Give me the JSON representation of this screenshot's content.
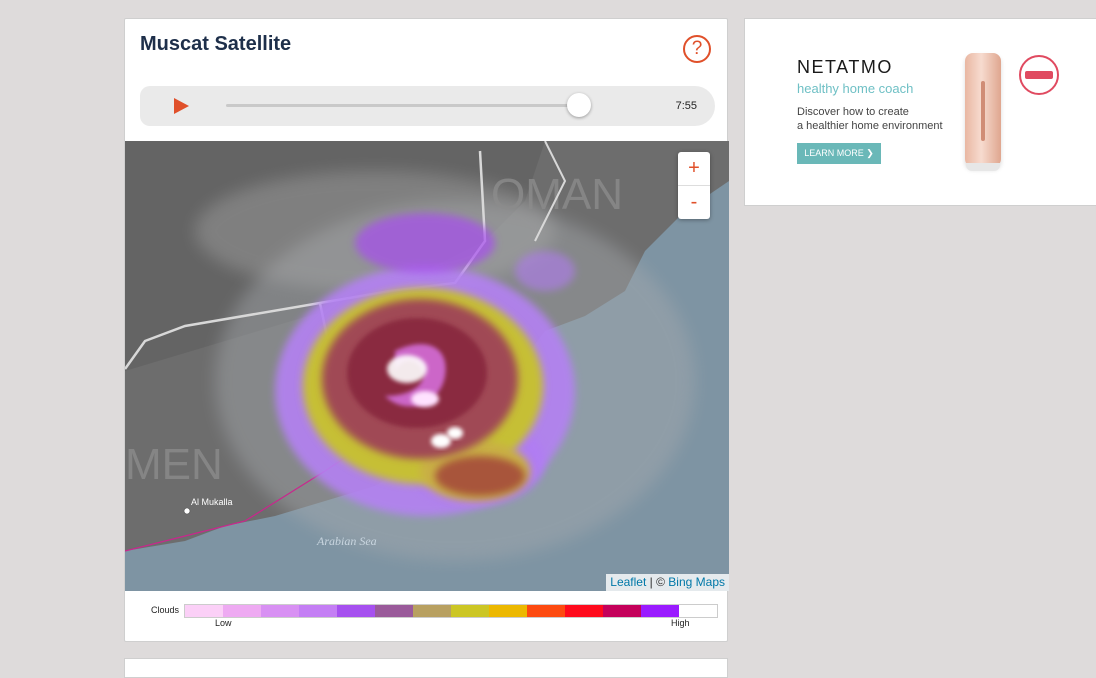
{
  "card": {
    "title": "Muscat Satellite",
    "help_icon": "question-circle-icon",
    "accent_color": "#e0502a"
  },
  "player": {
    "play_icon": "play-icon",
    "time": "7:55",
    "progress": 0.97
  },
  "map": {
    "labels": {
      "oman": "OMAN",
      "yemen": "MEN",
      "city": "Al Mukalla",
      "sea": "Arabian Sea"
    },
    "zoom_in": "+",
    "zoom_out": "-",
    "attribution": {
      "leaflet": "Leaflet",
      "separator": "| ©",
      "bing": "Bing Maps"
    }
  },
  "legend": {
    "title": "Clouds",
    "low": "Low",
    "high": "High",
    "colors": [
      "#fbd0f7",
      "#eeaaf2",
      "#d890f3",
      "#c47ef4",
      "#a650ef",
      "#9a5a9a",
      "#b8a060",
      "#ccc624",
      "#ecb800",
      "#fd4a10",
      "#ff0a1c",
      "#c4005a",
      "#9a1bff",
      "#ffffff"
    ]
  },
  "ad": {
    "brand": "NETATMO",
    "tagline": "healthy home coach",
    "line1": "Discover how to create",
    "line2": "a healthier home environment",
    "cta": "LEARN MORE  ❯"
  }
}
